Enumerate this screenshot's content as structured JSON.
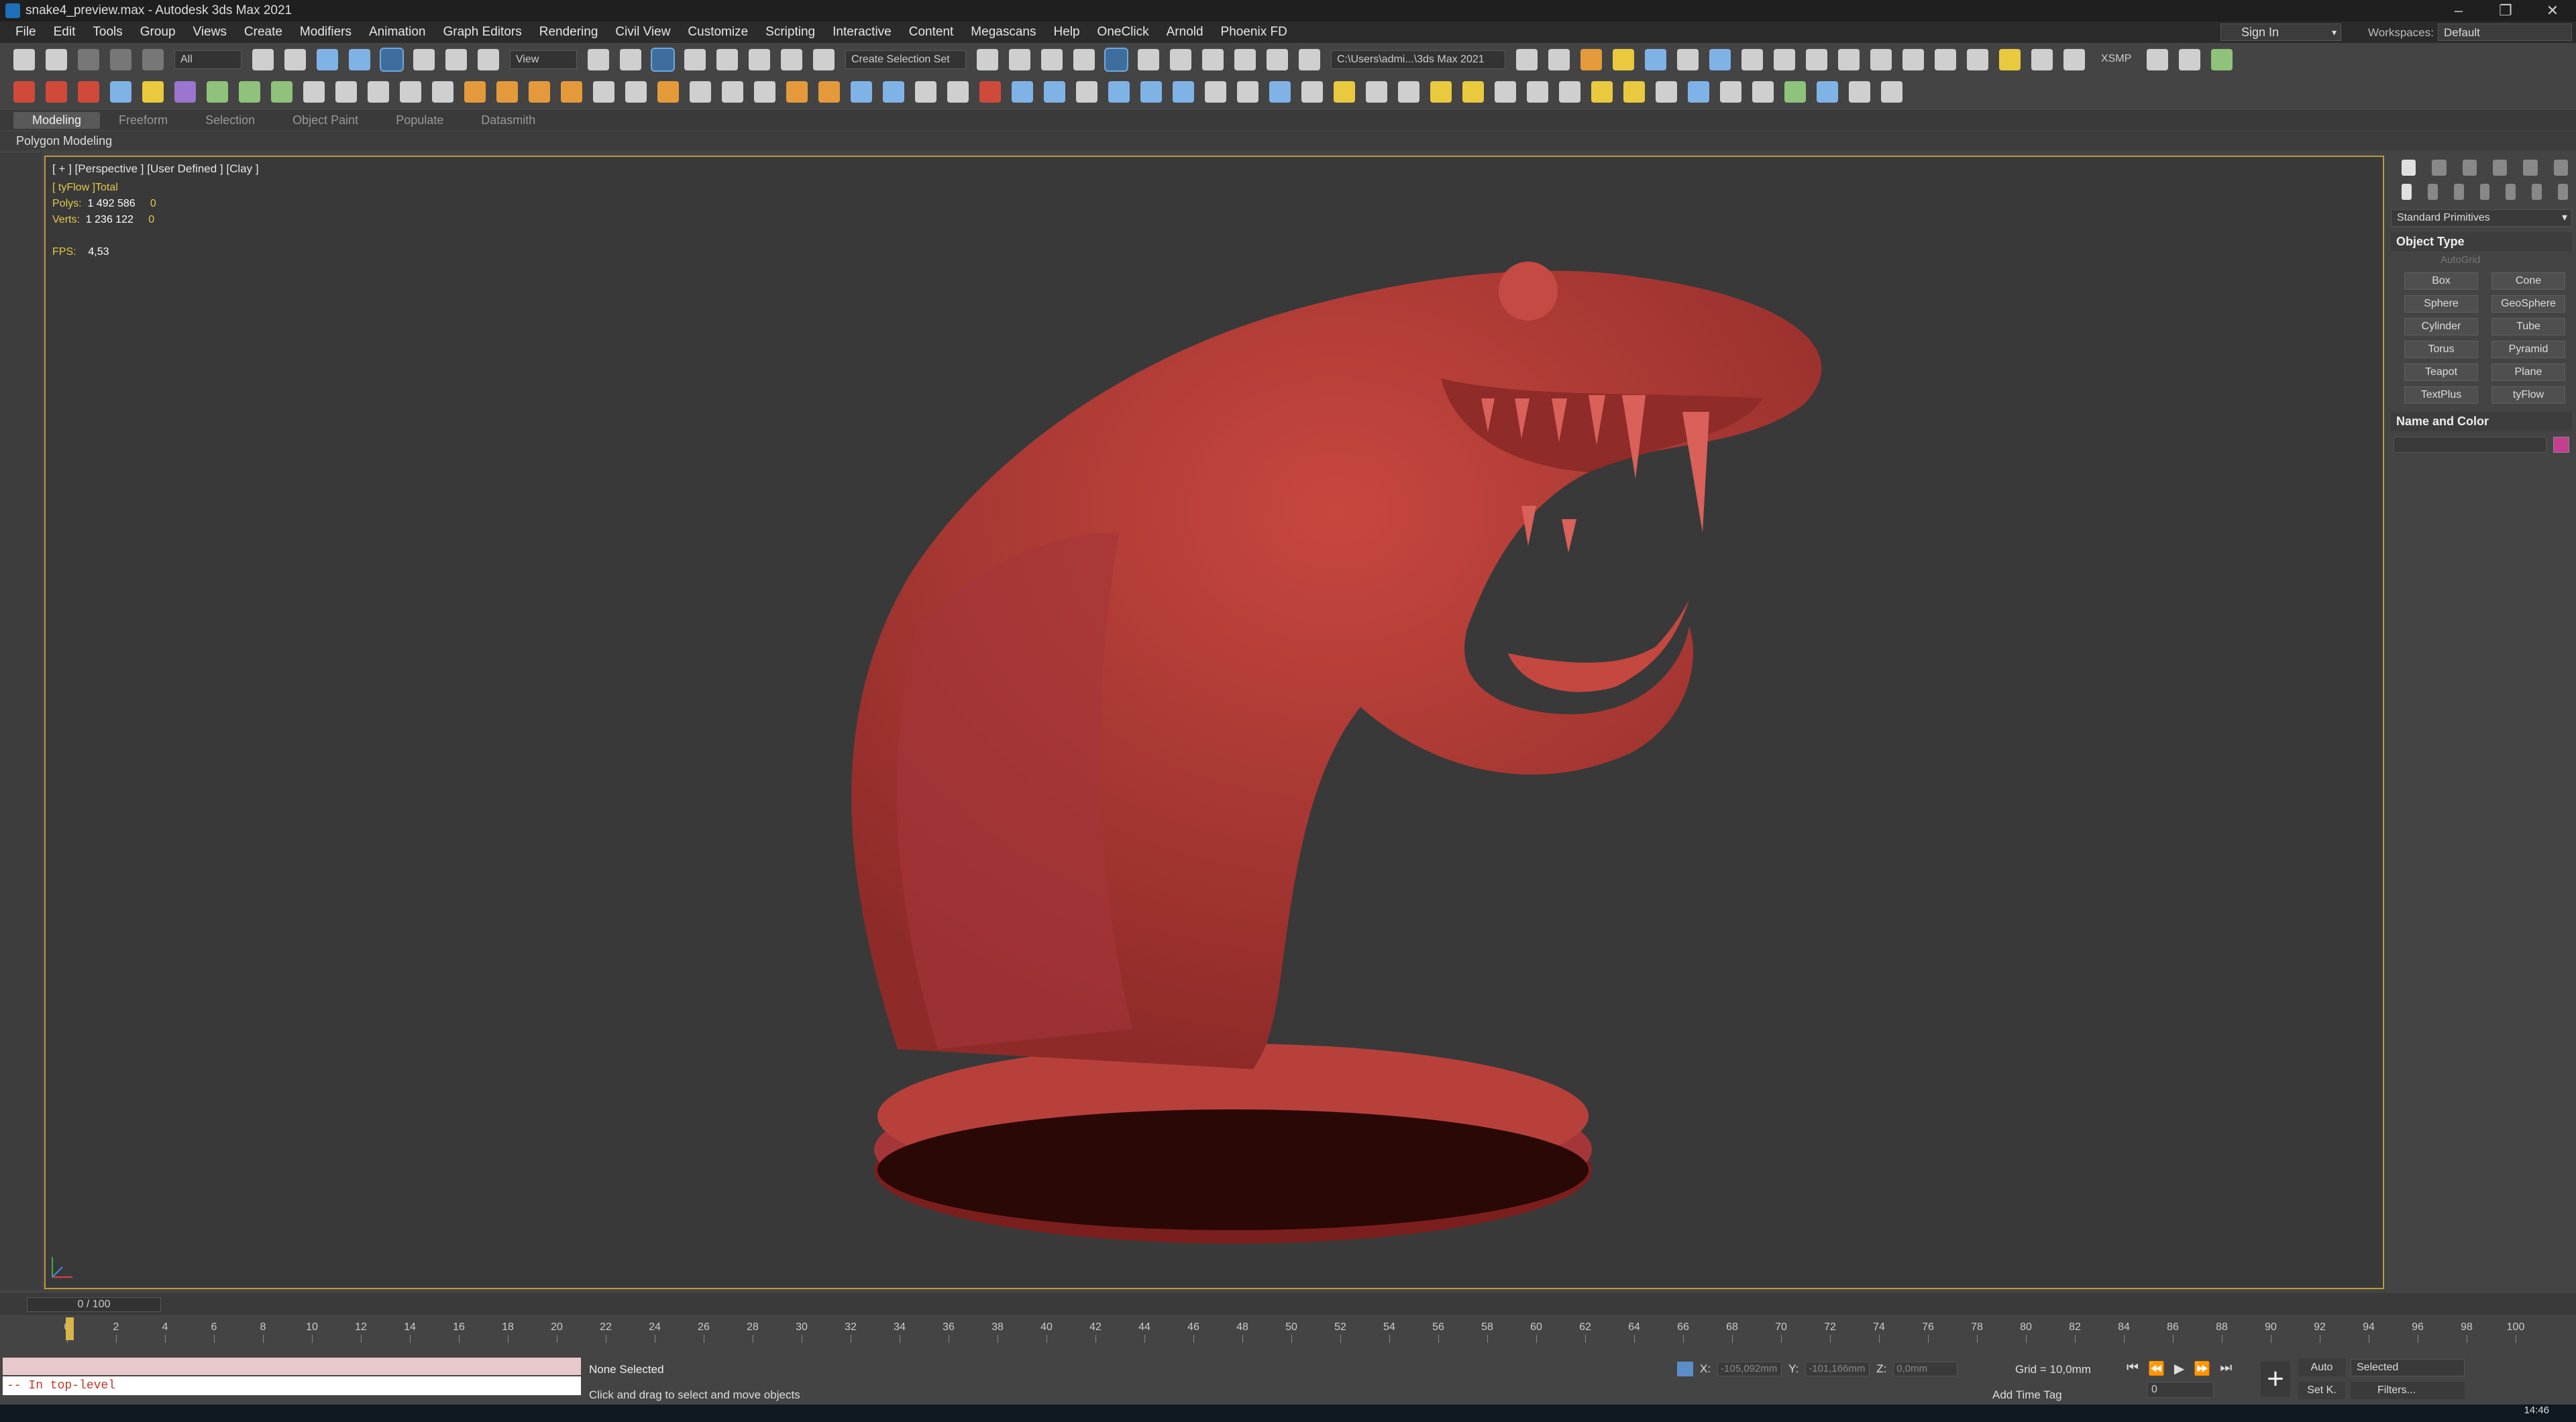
{
  "window": {
    "title": "snake4_preview.max - Autodesk 3ds Max 2021"
  },
  "menu": [
    "File",
    "Edit",
    "Tools",
    "Group",
    "Views",
    "Create",
    "Modifiers",
    "Animation",
    "Graph Editors",
    "Rendering",
    "Civil View",
    "Customize",
    "Scripting",
    "Interactive",
    "Content",
    "Megascans",
    "Help",
    "OneClick",
    "Arnold",
    "Phoenix FD"
  ],
  "account": {
    "signin": "Sign In",
    "workspaces_label": "Workspaces:",
    "workspace": "Default"
  },
  "toolbar": {
    "filter": "All",
    "ref_coord": "View",
    "selection_set": "Create Selection Set",
    "project_path": "C:\\Users\\admi...\\3ds Max 2021",
    "xsmp": "XSMP"
  },
  "ribbon": {
    "tabs": [
      "Modeling",
      "Freeform",
      "Selection",
      "Object Paint",
      "Populate",
      "Datasmith"
    ],
    "active": "Modeling",
    "sub": "Polygon Modeling"
  },
  "viewport": {
    "label": "[ + ] [Perspective ] [User Defined ] [Clay ]",
    "stats_header": "[ tyFlow ]Total",
    "polys_label": "Polys:",
    "polys_value": "1 492 586",
    "polys_sel": "0",
    "verts_label": "Verts:",
    "verts_value": "1 236 122",
    "verts_sel": "0",
    "fps_label": "FPS:",
    "fps_value": "4,53"
  },
  "command_panel": {
    "category": "Standard Primitives",
    "rollout_object_type": "Object Type",
    "autogrid": "AutoGrid",
    "buttons": [
      "Box",
      "Cone",
      "Sphere",
      "GeoSphere",
      "Cylinder",
      "Tube",
      "Torus",
      "Pyramid",
      "Teapot",
      "Plane",
      "TextPlus",
      "tyFlow"
    ],
    "rollout_name_color": "Name and Color",
    "object_color": "#c43f8e"
  },
  "timeline": {
    "slider": "0 / 100",
    "ticks": [
      "0",
      "2",
      "4",
      "6",
      "8",
      "10",
      "12",
      "14",
      "16",
      "18",
      "20",
      "22",
      "24",
      "26",
      "28",
      "30",
      "32",
      "34",
      "36",
      "38",
      "40",
      "42",
      "44",
      "46",
      "48",
      "50",
      "52",
      "54",
      "56",
      "58",
      "60",
      "62",
      "64",
      "66",
      "68",
      "70",
      "72",
      "74",
      "76",
      "78",
      "80",
      "82",
      "84",
      "86",
      "88",
      "90",
      "92",
      "94",
      "96",
      "98",
      "100"
    ]
  },
  "status": {
    "maxscript_output": "-- In top-level",
    "selection": "None Selected",
    "prompt": "Click and drag to select and move objects",
    "x_label": "X:",
    "x_value": "-105,092mm",
    "y_label": "Y:",
    "y_value": "-101,166mm",
    "z_label": "Z:",
    "z_value": "0,0mm",
    "grid": "Grid = 10,0mm",
    "add_time_tag": "Add Time Tag",
    "frame": "0",
    "auto": "Auto",
    "setk": "Set K.",
    "selected": "Selected",
    "filters": "Filters...",
    "clock": "14:46"
  },
  "colors": {
    "viewport_bg": "#393939",
    "model": "#b8403b",
    "active_border": "#b89b3e"
  }
}
